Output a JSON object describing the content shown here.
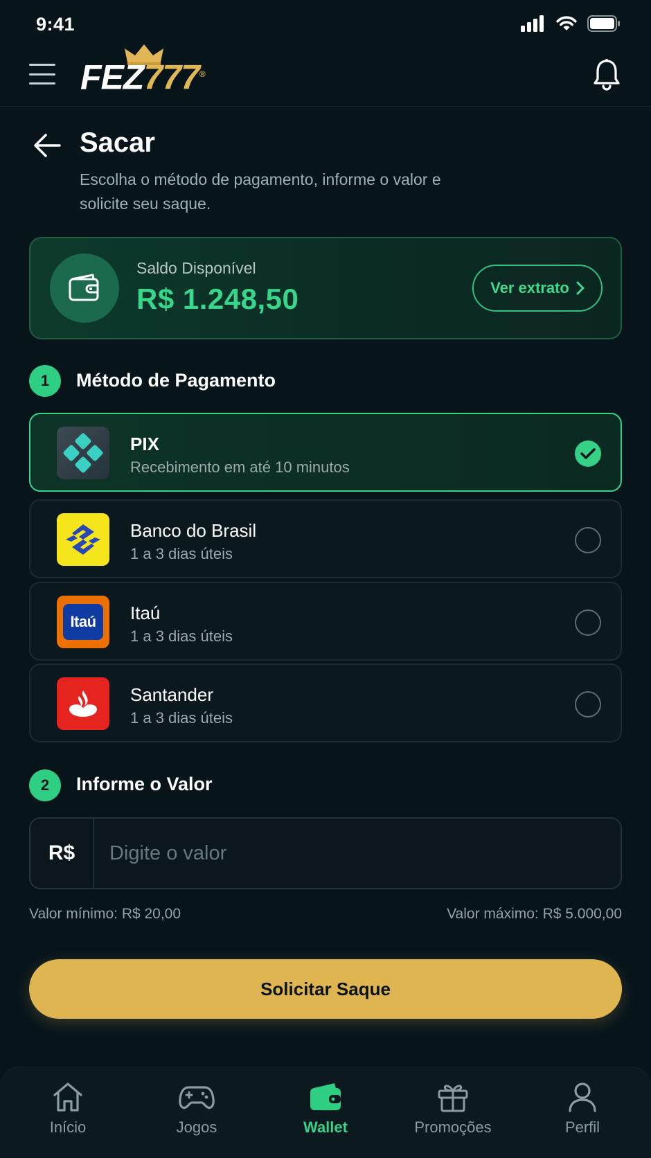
{
  "status_bar": {
    "time": "9:41"
  },
  "header": {
    "logo_primary": "FEZ",
    "logo_secondary": "777",
    "logo_mark": "®"
  },
  "page": {
    "title": "Sacar",
    "subtitle": "Escolha o método de pagamento, informe o valor e solicite seu saque."
  },
  "balance": {
    "label": "Saldo Disponível",
    "value": "R$ 1.248,50",
    "statement_button": "Ver extrato"
  },
  "payment_section": {
    "step": "1",
    "title": "Método de Pagamento"
  },
  "methods": [
    {
      "name": "PIX",
      "description": "Recebimento em até 10 minutos",
      "selected": true,
      "icon": "pix-icon"
    },
    {
      "name": "Banco do Brasil",
      "description": "1 a 3 dias úteis",
      "selected": false,
      "icon": "banco-do-brasil-logo"
    },
    {
      "name": "Itaú",
      "description": "1 a 3 dias úteis",
      "selected": false,
      "icon": "itau-logo",
      "logo_text": "Itaú"
    },
    {
      "name": "Santander",
      "description": "1 a 3 dias úteis",
      "selected": false,
      "icon": "santander-logo"
    }
  ],
  "amount_section": {
    "step": "2",
    "title": "Informe o Valor",
    "currency": "R$",
    "placeholder": "Digite o valor",
    "value": "",
    "min_label": "Valor mínimo: R$ 20,00",
    "max_label": "Valor máximo: R$ 5.000,00"
  },
  "submit_label": "Solicitar Saque",
  "bottom_nav": [
    {
      "label": "Início",
      "icon": "home-icon",
      "active": false
    },
    {
      "label": "Jogos",
      "icon": "gamepad-icon",
      "active": false
    },
    {
      "label": "Wallet",
      "icon": "wallet-icon",
      "active": true
    },
    {
      "label": "Promoções",
      "icon": "gift-icon",
      "active": false
    },
    {
      "label": "Perfil",
      "icon": "user-icon",
      "active": false
    }
  ],
  "colors": {
    "background": "#07141a",
    "accent_green": "#38d68a",
    "accent_gold": "#dfb552",
    "muted_text": "#9aa9ae"
  }
}
